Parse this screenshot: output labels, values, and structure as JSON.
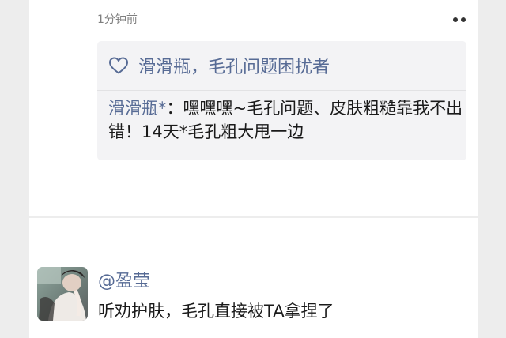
{
  "top_card": {
    "timestamp": "1分钟前",
    "more_icon": "more-dots-icon",
    "like": {
      "icon": "heart-outline-icon",
      "text": "滑滑瓶，毛孔问题困扰者"
    },
    "comment": {
      "author": "滑滑瓶*",
      "separator": "：",
      "text": "嘿嘿嘿~毛孔问题、皮肤粗糙靠我不出错！14天*毛孔粗大甩一边"
    }
  },
  "next_post": {
    "avatar_icon": "user-avatar-photo",
    "author": "@盈莹",
    "text": "听劝护肤，毛孔直接被TA拿捏了"
  },
  "colors": {
    "link_blue": "#576b95",
    "background": "#ededed",
    "card": "#ffffff",
    "like_box": "#f3f3f5"
  }
}
